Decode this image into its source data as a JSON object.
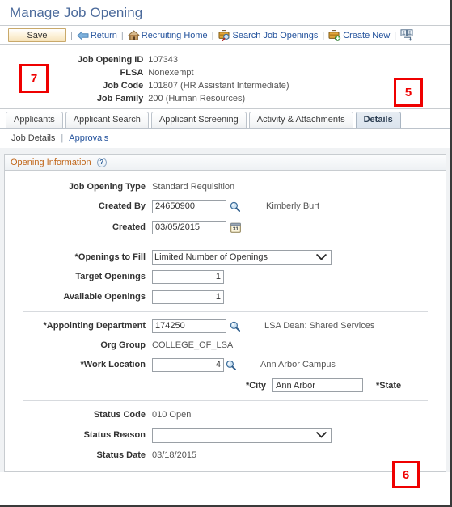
{
  "page": {
    "title": "Manage Job Opening"
  },
  "toolbar": {
    "save_label": "Save",
    "separator": "|",
    "links": [
      {
        "label": "Return",
        "icon": "back-arrow-icon"
      },
      {
        "label": "Recruiting Home",
        "icon": "home-icon"
      },
      {
        "label": "Search Job Openings",
        "icon": "search-briefcase-icon"
      },
      {
        "label": "Create New",
        "icon": "new-briefcase-icon"
      }
    ],
    "end_icon": "personalize-icon"
  },
  "header": {
    "fields": [
      {
        "label": "Job Opening ID",
        "value": "107343"
      },
      {
        "label": "FLSA",
        "value": "Nonexempt"
      },
      {
        "label": "Job Code",
        "value": "101807 (HR Assistant Intermediate)"
      },
      {
        "label": "Job Family",
        "value": "200 (Human Resources)"
      }
    ]
  },
  "annotations": [
    {
      "number": "7"
    },
    {
      "number": "5"
    },
    {
      "number": "6"
    }
  ],
  "tabs": [
    {
      "label": "Applicants",
      "active": false
    },
    {
      "label": "Applicant Search",
      "active": false
    },
    {
      "label": "Applicant Screening",
      "active": false
    },
    {
      "label": "Activity & Attachments",
      "active": false
    },
    {
      "label": "Details",
      "active": true
    }
  ],
  "subnav": {
    "current": "Job Details",
    "separator": "|",
    "link": "Approvals"
  },
  "panel": {
    "title": "Opening Information",
    "help_icon_label": "?"
  },
  "form": {
    "job_opening_type": {
      "label": "Job Opening Type",
      "value": "Standard Requisition"
    },
    "created_by": {
      "label": "Created By",
      "value": "24650900",
      "after": "Kimberly Burt",
      "lookup_icon": "magnifier-icon"
    },
    "created": {
      "label": "Created",
      "value": "03/05/2015",
      "calendar_icon": "calendar-icon"
    },
    "openings_to_fill": {
      "label": "*Openings to Fill",
      "value": "Limited Number of Openings",
      "caret_icon": "chevron-down-icon"
    },
    "target_openings": {
      "label": "Target Openings",
      "value": "1"
    },
    "available_openings": {
      "label": "Available Openings",
      "value": "1"
    },
    "appointing_department": {
      "label": "*Appointing Department",
      "value": "174250",
      "after": "LSA Dean: Shared Services",
      "lookup_icon": "magnifier-icon"
    },
    "org_group": {
      "label": "Org Group",
      "value": "COLLEGE_OF_LSA"
    },
    "work_location": {
      "label": "*Work Location",
      "value": "4",
      "after": "Ann Arbor Campus",
      "lookup_icon": "magnifier-icon"
    },
    "city": {
      "label": "*City",
      "value": "Ann Arbor"
    },
    "state": {
      "label": "*State"
    },
    "status_code": {
      "label": "Status Code",
      "value": "010 Open"
    },
    "status_reason": {
      "label": "Status Reason",
      "value": "",
      "caret_icon": "chevron-down-icon"
    },
    "status_date": {
      "label": "Status Date",
      "value": "03/18/2015"
    }
  },
  "colors": {
    "title_blue": "#4b6a9b",
    "link_blue": "#23529c",
    "panel_orange": "#c06518",
    "annotation_red": "#ef0000",
    "save_gold": "#f6e3bb"
  }
}
